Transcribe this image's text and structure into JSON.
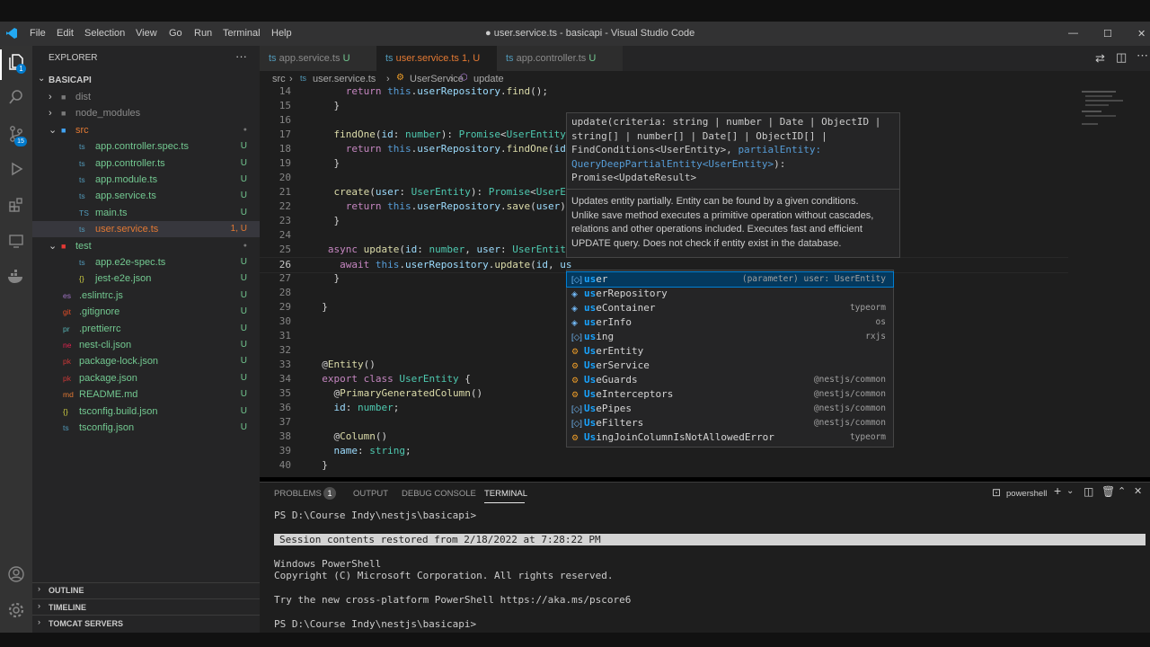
{
  "window_title": "● user.service.ts - basicapi - Visual Studio Code",
  "menu": [
    "File",
    "Edit",
    "Selection",
    "View",
    "Go",
    "Run",
    "Terminal",
    "Help"
  ],
  "window_controls": {
    "minimize": "—",
    "maximize": "☐",
    "close": "✕"
  },
  "sidebar": {
    "title": "EXPLORER",
    "more": "···",
    "project": "BASICAPI",
    "items": [
      {
        "label": "dist",
        "type": "folder",
        "status": "",
        "indent": 1,
        "color": "#8a8a8a"
      },
      {
        "label": "node_modules",
        "type": "folder",
        "status": "",
        "indent": 1,
        "color": "#8a8a8a"
      },
      {
        "label": "src",
        "type": "folder-open",
        "status": "●",
        "indent": 1,
        "color": "#e37933"
      },
      {
        "label": "app.controller.spec.ts",
        "type": "file",
        "status": "U",
        "indent": 2,
        "color": "#73c991",
        "icon": "ts"
      },
      {
        "label": "app.controller.ts",
        "type": "file",
        "status": "U",
        "indent": 2,
        "color": "#73c991",
        "icon": "ts"
      },
      {
        "label": "app.module.ts",
        "type": "file",
        "status": "U",
        "indent": 2,
        "color": "#73c991",
        "icon": "ts"
      },
      {
        "label": "app.service.ts",
        "type": "file",
        "status": "U",
        "indent": 2,
        "color": "#73c991",
        "icon": "ts"
      },
      {
        "label": "main.ts",
        "type": "file",
        "status": "U",
        "indent": 2,
        "color": "#73c991",
        "icon": "TS"
      },
      {
        "label": "user.service.ts",
        "type": "file",
        "status": "1, U",
        "indent": 2,
        "color": "#e37933",
        "icon": "ts",
        "selected": true
      },
      {
        "label": "test",
        "type": "folder-open",
        "status": "●",
        "indent": 1,
        "color": "#73c991"
      },
      {
        "label": "app.e2e-spec.ts",
        "type": "file",
        "status": "U",
        "indent": 2,
        "color": "#73c991",
        "icon": "ts"
      },
      {
        "label": "jest-e2e.json",
        "type": "file",
        "status": "U",
        "indent": 2,
        "color": "#73c991",
        "icon": "{}"
      },
      {
        "label": ".eslintrc.js",
        "type": "file",
        "status": "U",
        "indent": 1,
        "color": "#73c991",
        "icon": "es"
      },
      {
        "label": ".gitignore",
        "type": "file",
        "status": "U",
        "indent": 1,
        "color": "#73c991",
        "icon": "git"
      },
      {
        "label": ".prettierrc",
        "type": "file",
        "status": "U",
        "indent": 1,
        "color": "#73c991",
        "icon": "pr"
      },
      {
        "label": "nest-cli.json",
        "type": "file",
        "status": "U",
        "indent": 1,
        "color": "#73c991",
        "icon": "ne"
      },
      {
        "label": "package-lock.json",
        "type": "file",
        "status": "U",
        "indent": 1,
        "color": "#73c991",
        "icon": "pk"
      },
      {
        "label": "package.json",
        "type": "file",
        "status": "U",
        "indent": 1,
        "color": "#73c991",
        "icon": "pk"
      },
      {
        "label": "README.md",
        "type": "file",
        "status": "U",
        "indent": 1,
        "color": "#73c991",
        "icon": "md"
      },
      {
        "label": "tsconfig.build.json",
        "type": "file",
        "status": "U",
        "indent": 1,
        "color": "#73c991",
        "icon": "{}"
      },
      {
        "label": "tsconfig.json",
        "type": "file",
        "status": "U",
        "indent": 1,
        "color": "#73c991",
        "icon": "ts"
      }
    ],
    "sections": [
      "OUTLINE",
      "TIMELINE",
      "TOMCAT SERVERS"
    ]
  },
  "tabs": [
    {
      "label": "app.service.ts",
      "status": "U",
      "active": false
    },
    {
      "label": "user.service.ts",
      "status": "1, U",
      "active": true,
      "dirty": "●"
    },
    {
      "label": "app.controller.ts",
      "status": "U",
      "active": false
    }
  ],
  "breadcrumb": [
    "src",
    "user.service.ts",
    "UserService",
    "update"
  ],
  "code_lines": [
    {
      "n": "14",
      "t": "      return this.userRepository.find();"
    },
    {
      "n": "15",
      "t": "    }"
    },
    {
      "n": "16",
      "t": ""
    },
    {
      "n": "17",
      "t": "    findOne(id: number): Promise<UserEntity>"
    },
    {
      "n": "18",
      "t": "      return this.userRepository.findOne(id)"
    },
    {
      "n": "19",
      "t": "    }"
    },
    {
      "n": "20",
      "t": ""
    },
    {
      "n": "21",
      "t": "    create(user: UserEntity): Promise<UserEn"
    },
    {
      "n": "22",
      "t": "      return this.userRepository.save(user);"
    },
    {
      "n": "23",
      "t": "    }"
    },
    {
      "n": "24",
      "t": ""
    },
    {
      "n": "25",
      "t": "   async update(id: number, user: UserEntity"
    },
    {
      "n": "26",
      "t": "     await this.userRepository.update(id, us"
    },
    {
      "n": "27",
      "t": "    }"
    },
    {
      "n": "28",
      "t": ""
    },
    {
      "n": "29",
      "t": "  }"
    },
    {
      "n": "30",
      "t": ""
    },
    {
      "n": "31",
      "t": ""
    },
    {
      "n": "32",
      "t": ""
    },
    {
      "n": "33",
      "t": "  @Entity()"
    },
    {
      "n": "34",
      "t": "  export class UserEntity {"
    },
    {
      "n": "35",
      "t": "    @PrimaryGeneratedColumn()"
    },
    {
      "n": "36",
      "t": "    id: number;"
    },
    {
      "n": "37",
      "t": ""
    },
    {
      "n": "38",
      "t": "    @Column()"
    },
    {
      "n": "39",
      "t": "    name: string;"
    },
    {
      "n": "40",
      "t": "  }"
    }
  ],
  "hover": {
    "signature_lines": [
      "update(criteria: string | number | Date | ObjectID |",
      "string[] | number[] | Date[] | ObjectID[] |",
      "FindConditions<UserEntity>, partialEntity:",
      "QueryDeepPartialEntity<UserEntity>):",
      "Promise<UpdateResult>"
    ],
    "doc_lines": [
      "Updates entity partially. Entity can be found by a given conditions.",
      "Unlike save method executes a primitive operation without cascades,",
      "relations and other operations included. Executes fast and efficient",
      "UPDATE query. Does not check if entity exist in the database."
    ]
  },
  "suggestions": [
    {
      "label": "user",
      "detail": "(parameter) user: UserEntity",
      "kind": "var",
      "selected": true
    },
    {
      "label": "userRepository",
      "detail": "",
      "kind": "prop"
    },
    {
      "label": "useContainer",
      "detail": "typeorm",
      "kind": "prop"
    },
    {
      "label": "userInfo",
      "detail": "os",
      "kind": "prop"
    },
    {
      "label": "using",
      "detail": "rxjs",
      "kind": "var"
    },
    {
      "label": "UserEntity",
      "detail": "",
      "kind": "class"
    },
    {
      "label": "UserService",
      "detail": "",
      "kind": "class"
    },
    {
      "label": "UseGuards",
      "detail": "@nestjs/common",
      "kind": "class"
    },
    {
      "label": "UseInterceptors",
      "detail": "@nestjs/common",
      "kind": "class"
    },
    {
      "label": "UsePipes",
      "detail": "@nestjs/common",
      "kind": "var"
    },
    {
      "label": "UseFilters",
      "detail": "@nestjs/common",
      "kind": "var"
    },
    {
      "label": "UsingJoinColumnIsNotAllowedError",
      "detail": "typeorm",
      "kind": "class"
    }
  ],
  "panel": {
    "tabs": [
      "PROBLEMS",
      "OUTPUT",
      "DEBUG CONSOLE",
      "TERMINAL"
    ],
    "problems_count": "1",
    "shell": "powershell",
    "lines": [
      "PS D:\\Course Indy\\nestjs\\basicapi>",
      "",
      "Session contents restored from 2/18/2022 at 7:28:22 PM",
      "",
      "Windows PowerShell",
      "Copyright (C) Microsoft Corporation. All rights reserved.",
      "",
      "Try the new cross-platform PowerShell https://aka.ms/pscore6",
      "",
      "PS D:\\Course Indy\\nestjs\\basicapi>"
    ]
  },
  "colors": {
    "accent": "#007acc",
    "untracked": "#73c991",
    "modified": "#e37933",
    "keyword": "#c586c0",
    "function": "#dcdcaa",
    "type": "#4ec9b0"
  }
}
